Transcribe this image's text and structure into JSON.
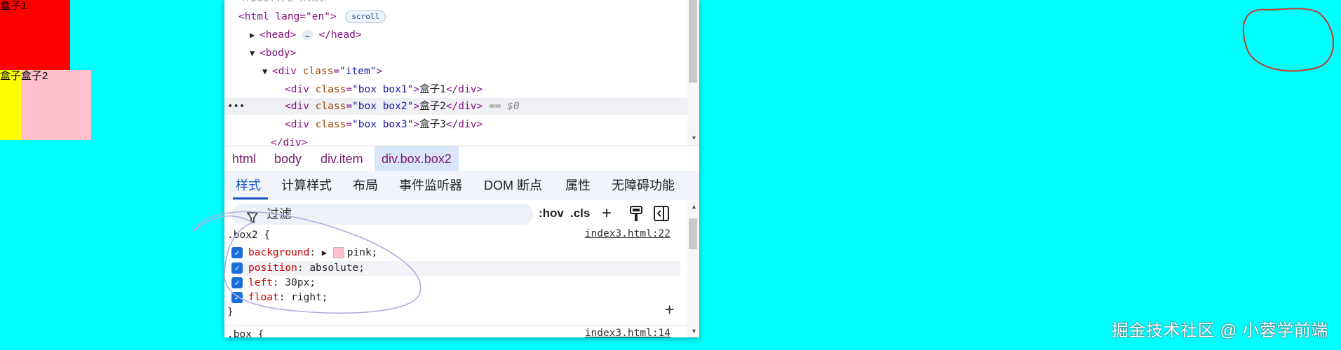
{
  "page": {
    "box1_text": "盒子1",
    "box2_text": "盒子2",
    "box3_text": "盒子"
  },
  "devtools": {
    "dom_tree": {
      "doctype_partial": "<!DOCTYPE html>",
      "html_open": "<html lang=\"en\">",
      "scroll_badge": "scroll",
      "head": {
        "open": "<head>",
        "ellipsis": "…",
        "close": "</head>"
      },
      "body_open": "<body>",
      "div_item": {
        "tag_open": "<div ",
        "attr_name": "class",
        "attr_value": "\"item\"",
        "tag_close": ">"
      },
      "children": [
        {
          "attr_value": "\"box box1\"",
          "text": "盒子1"
        },
        {
          "attr_value": "\"box box2\"",
          "text": "盒子2",
          "selected": true,
          "marker": "== $0"
        },
        {
          "attr_value": "\"box box3\"",
          "text": "盒子3"
        }
      ],
      "div_close": "</div>",
      "row_dots": "•••"
    },
    "breadcrumb": [
      "html",
      "body",
      "div.item",
      "div.box.box2"
    ],
    "tabs": [
      "样式",
      "计算样式",
      "布局",
      "事件监听器",
      "DOM 断点",
      "属性",
      "无障碍功能"
    ],
    "active_tab": "样式",
    "filter": {
      "placeholder": "过滤",
      "hov": ":hov",
      "cls": ".cls"
    },
    "rules": [
      {
        "selector": ".box2 {",
        "source": "index3.html:22",
        "declarations": [
          {
            "name": "background",
            "value": "pink;",
            "checked": true,
            "swatch": "#ffc0cb"
          },
          {
            "name": "position",
            "value": "absolute;",
            "checked": true
          },
          {
            "name": "left",
            "value": "30px;",
            "checked": true
          },
          {
            "name": "float",
            "value": "right;",
            "checked": true
          }
        ],
        "close": "}"
      },
      {
        "selector": ".box {",
        "source": "index3.html:14"
      }
    ]
  },
  "watermark": "掘金技术社区 @ 小蓉学前端",
  "colors": {
    "background": "#00ffff",
    "box1": "#ff0000",
    "box2": "#ffc0cb",
    "box3": "#ffff00",
    "accent": "#1a57c4",
    "annotation_red": "#c0392b",
    "annotation_purple": "#b4a9e0"
  }
}
